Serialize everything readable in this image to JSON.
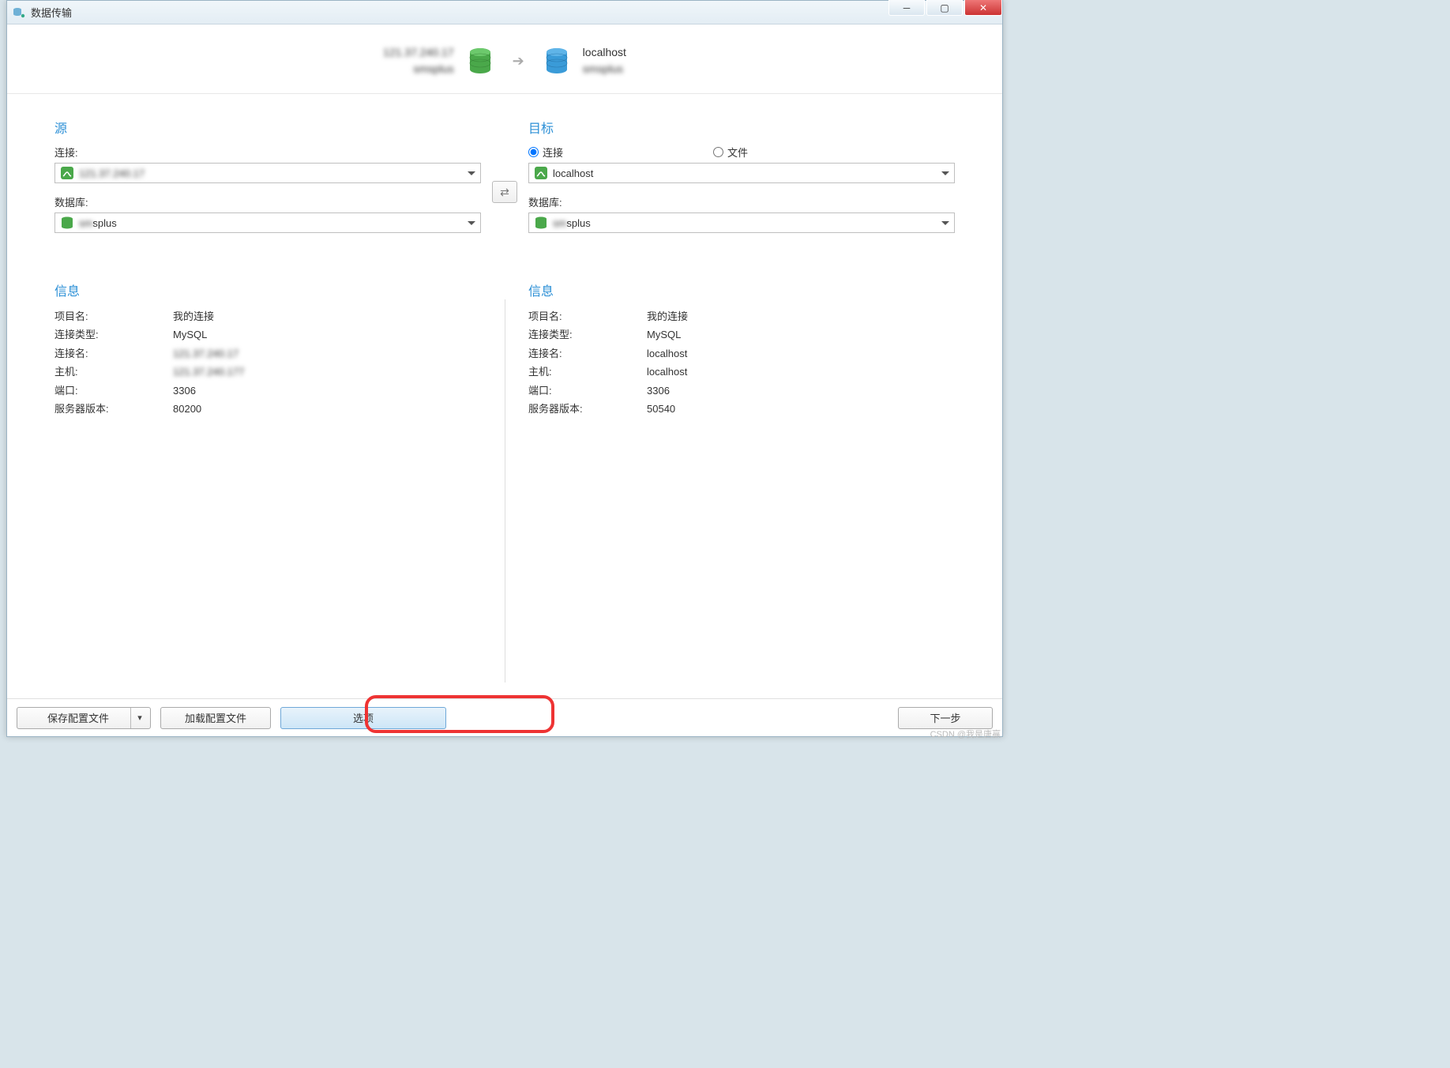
{
  "window": {
    "title": "数据传输"
  },
  "summary": {
    "source_host": "121.37.240.17",
    "source_db": "smsplus",
    "target_host": "localhost",
    "target_db": "smsplus"
  },
  "source": {
    "title": "源",
    "conn_label": "连接:",
    "conn_value": "121.37.240.17",
    "db_label": "数据库:",
    "db_value": "smsplus"
  },
  "target": {
    "title": "目标",
    "radio_conn": "连接",
    "radio_file": "文件",
    "conn_value": "localhost",
    "db_label": "数据库:",
    "db_value": "smsplus"
  },
  "info_title": "信息",
  "info_keys": {
    "project": "项目名:",
    "conn_type": "连接类型:",
    "conn_name": "连接名:",
    "host": "主机:",
    "port": "端口:",
    "version": "服务器版本:"
  },
  "source_info": {
    "project": "我的连接",
    "conn_type": "MySQL",
    "conn_name": "121.37.240.17",
    "host": "121.37.240.177",
    "port": "3306",
    "version": "80200"
  },
  "target_info": {
    "project": "我的连接",
    "conn_type": "MySQL",
    "conn_name": "localhost",
    "host": "localhost",
    "port": "3306",
    "version": "50540"
  },
  "footer": {
    "save_profile": "保存配置文件",
    "load_profile": "加载配置文件",
    "options": "选项",
    "next": "下一步"
  },
  "watermark": "CSDN @我是唐赢"
}
